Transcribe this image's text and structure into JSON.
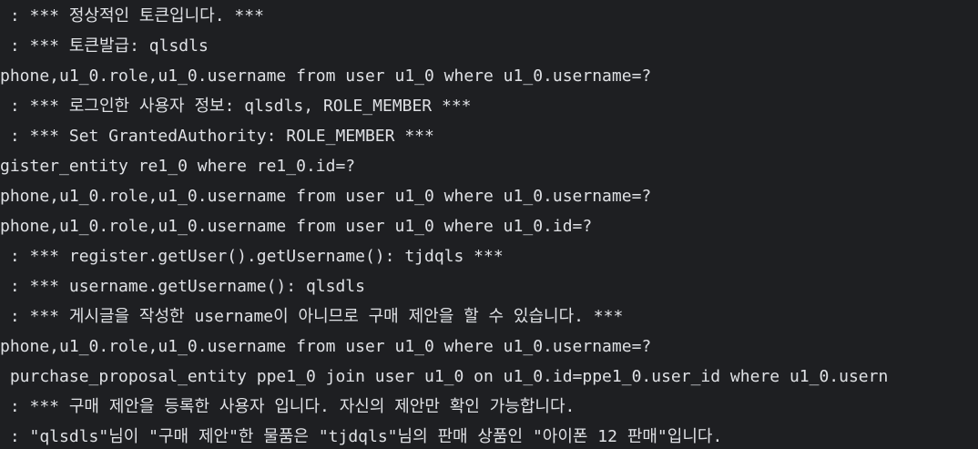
{
  "console": {
    "lines": [
      " : *** 정상적인 토큰입니다. ***",
      " : *** 토큰발급: qlsdls",
      "phone,u1_0.role,u1_0.username from user u1_0 where u1_0.username=?",
      " : *** 로그인한 사용자 정보: qlsdls, ROLE_MEMBER ***",
      " : *** Set GrantedAuthority: ROLE_MEMBER ***",
      "gister_entity re1_0 where re1_0.id=?",
      "phone,u1_0.role,u1_0.username from user u1_0 where u1_0.username=?",
      "phone,u1_0.role,u1_0.username from user u1_0 where u1_0.id=?",
      " : *** register.getUser().getUsername(): tjdqls ***",
      " : *** username.getUsername(): qlsdls",
      " : *** 게시글을 작성한 username이 아니므로 구매 제안을 할 수 있습니다. ***",
      "phone,u1_0.role,u1_0.username from user u1_0 where u1_0.username=?",
      " purchase_proposal_entity ppe1_0 join user u1_0 on u1_0.id=ppe1_0.user_id where u1_0.usern",
      " : *** 구매 제안을 등록한 사용자 입니다. 자신의 제안만 확인 가능합니다.",
      " : \"qlsdls\"님이 \"구매 제안\"한 물품은 \"tjdqls\"님의 판매 상품인 \"아이폰 12 판매\"입니다."
    ]
  },
  "colors": {
    "background": "#1e1f22",
    "text": "#dfe1e5"
  }
}
